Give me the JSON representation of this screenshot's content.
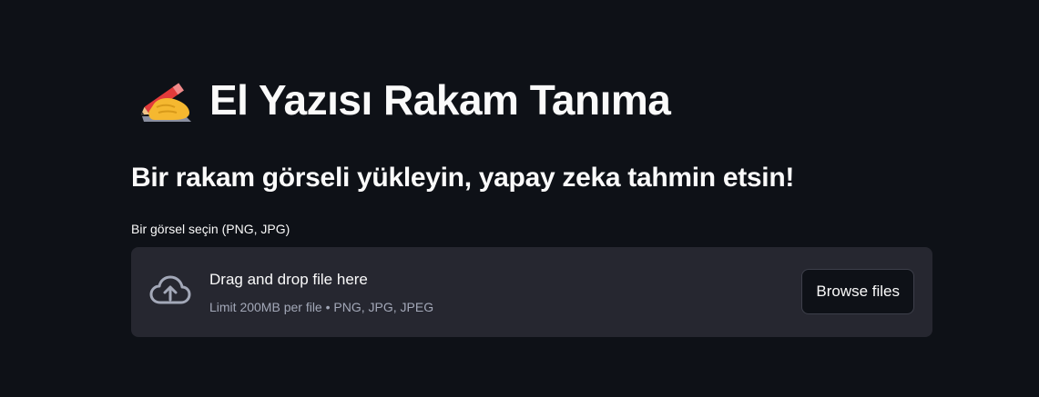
{
  "header": {
    "title": "El Yazısı Rakam Tanıma",
    "title_icon": "writing-hand-emoji",
    "subtitle": "Bir rakam görseli yükleyin, yapay zeka tahmin etsin!"
  },
  "uploader": {
    "label": "Bir görsel seçin (PNG, JPG)",
    "drop_text": "Drag and drop file here",
    "limit_text": "Limit 200MB per file • PNG, JPG, JPEG",
    "button_label": "Browse files",
    "icon": "cloud-upload-icon"
  },
  "colors": {
    "background": "#0e1117",
    "dropzone": "#262730",
    "text": "#fafafa",
    "muted_text": "#a3a8b8"
  }
}
